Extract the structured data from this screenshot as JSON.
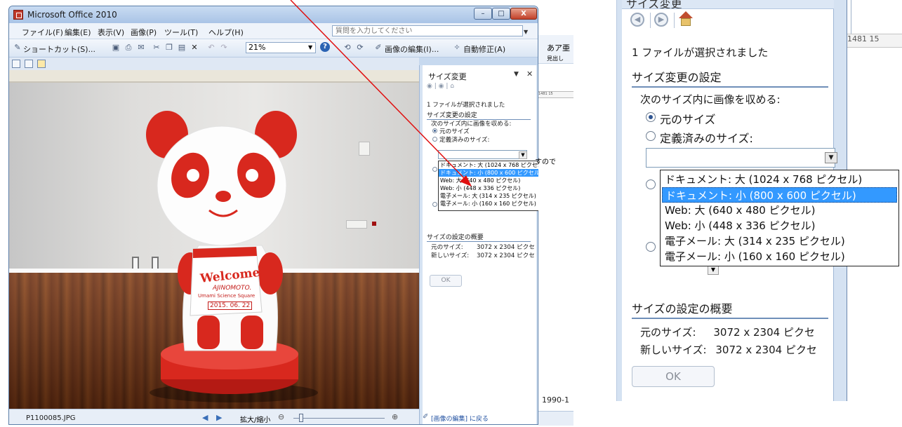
{
  "window": {
    "title": "Microsoft Office 2010",
    "min_glyph": "–",
    "max_glyph": "□",
    "close_glyph": "X"
  },
  "menu": {
    "items": [
      "ファイル(F)",
      "編集(E)",
      "表示(V)",
      "画像(P)",
      "ツール(T)",
      "ヘルプ(H)"
    ],
    "help_placeholder": "質問を入力してください"
  },
  "toolbar": {
    "shortcut": "ショートカット(S)...",
    "zoom_value": "21%",
    "edit_picture": "画像の編集(I)...",
    "auto_correct": "自動修正(A)"
  },
  "statusbar": {
    "file_name": "P1100085.JPG",
    "zoom_label": "拡大/縮小",
    "zoom_fraction": 0.06
  },
  "taskpane": {
    "title": "サイズ変更",
    "selected_text": "1 ファイルが選択されました",
    "section_resize": "サイズ変更の設定",
    "fit_label": "次のサイズ内に画像を収める:",
    "opt_original": "元のサイズ",
    "opt_predefined": "定義済みのサイズ:",
    "options": [
      "ドキュメント: 大 (1024 x 768 ピクセル)",
      "ドキュメント: 小 (800 x 600 ピクセル)",
      "Web: 大 (640 x 480 ピクセル)",
      "Web: 小 (448 x 336 ピクセル)",
      "電子メール: 大 (314 x 235 ピクセル)",
      "電子メール: 小 (160 x 160 ピクセル)"
    ],
    "selected_option_index": 1,
    "section_summary": "サイズの設定の概要",
    "original_size_label": "元のサイズ:",
    "original_size_value": "3072 x 2304 ピクセ",
    "new_size_label": "新しいサイズ:",
    "new_size_value": "3072 x 2304 ピクセ",
    "ok_label": "OK",
    "back_link": "[画像の編集] に戻る"
  },
  "photo": {
    "sign_line1": "Welcome!",
    "sign_line2": "AJINOMOTO.",
    "sign_line3": "Umami Science Square",
    "sign_date": "2015. 06. 22"
  },
  "background_doc": {
    "text1": "あア亜",
    "text2": "見出し",
    "ruler": "1481  15",
    "side_text": "すので",
    "year_text": "1990-1"
  },
  "colors": {
    "accent_blue": "#3399ff",
    "panda_red": "#d8281e",
    "arrow_red": "#e01010"
  }
}
